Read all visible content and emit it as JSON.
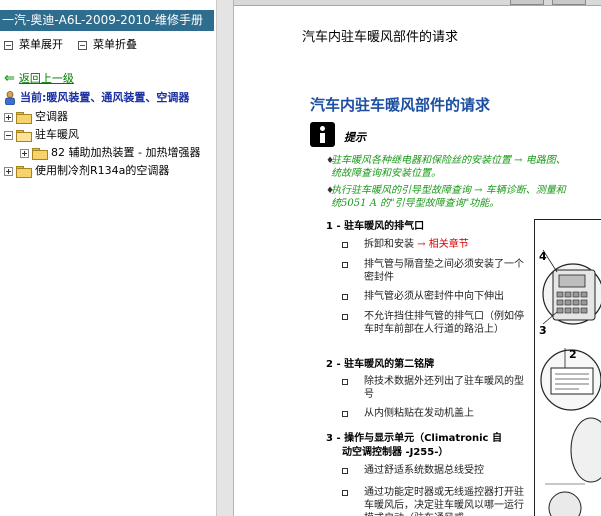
{
  "window": {
    "title": "一汽-奥迪-A6L-2009-2010-维修手册"
  },
  "nav": {
    "expand_label": "菜单展开",
    "collapse_label": "菜单折叠",
    "back_label": "返回上一级",
    "current_label": "当前:暖风装置、通风装置、空调器",
    "tree": [
      {
        "label": "空调器",
        "expanded": false
      },
      {
        "label": "驻车暖风",
        "expanded": true
      },
      {
        "label": "82 辅助加热装置 - 加热增强器",
        "expanded": false
      },
      {
        "label": "使用制冷剂R134a的空调器",
        "expanded": false
      }
    ]
  },
  "doc": {
    "header": "汽车内驻车暖风部件的请求",
    "title": "汽车内驻车暖风部件的请求",
    "hint_label": "提示",
    "hint_notes": [
      {
        "line1_black": "驻车暖风各种继电器和保险丝的安装位置",
        "line1_link": " → 电路图、",
        "line2_black": "统故障查询和安装位置。"
      },
      {
        "line1_black": "执行驻车暖风的引导型故障查询",
        "line1_link": " → 车辆诊断、测量和",
        "line2_black": "统5051 A 的\"引导型故障查询\"功能。"
      }
    ],
    "sections": [
      {
        "heading": "1 - 驻车暖风的排气口",
        "items": [
          {
            "text": "拆卸和安装",
            "link": " → 相关章节"
          },
          {
            "text": "排气管与隔音垫之间必须安装了一个密封件"
          },
          {
            "text": "排气管必须从密封件中向下伸出"
          },
          {
            "text": "不允许挡住排气管的排气口（例如停车时车前部在人行道的路沿上）"
          }
        ]
      },
      {
        "heading": "2 - 驻车暖风的第二铭牌",
        "items": [
          {
            "text": "除技术数据外还列出了驻车暖风的型号"
          },
          {
            "text": "从内侧粘贴在发动机盖上"
          }
        ]
      },
      {
        "heading_line1": "3 - 操作与显示单元（Climatronic 自",
        "heading_line2": "动空调控制器 -J255-）",
        "items": [
          {
            "text": "通过舒适系统数据总线受控"
          },
          {
            "text": "通过功能定时器或无线遥控器打开驻车暖风后，决定驻车暖风以哪一运行模式启动（驻车通风或"
          }
        ]
      }
    ],
    "figure_labels": [
      "4",
      "3",
      "2"
    ]
  },
  "colors": {
    "titlebar_bg": "#2f6d8f",
    "title_blue": "#1d4fa0",
    "link_green": "#1a9a1a",
    "link_red": "#d40000"
  }
}
